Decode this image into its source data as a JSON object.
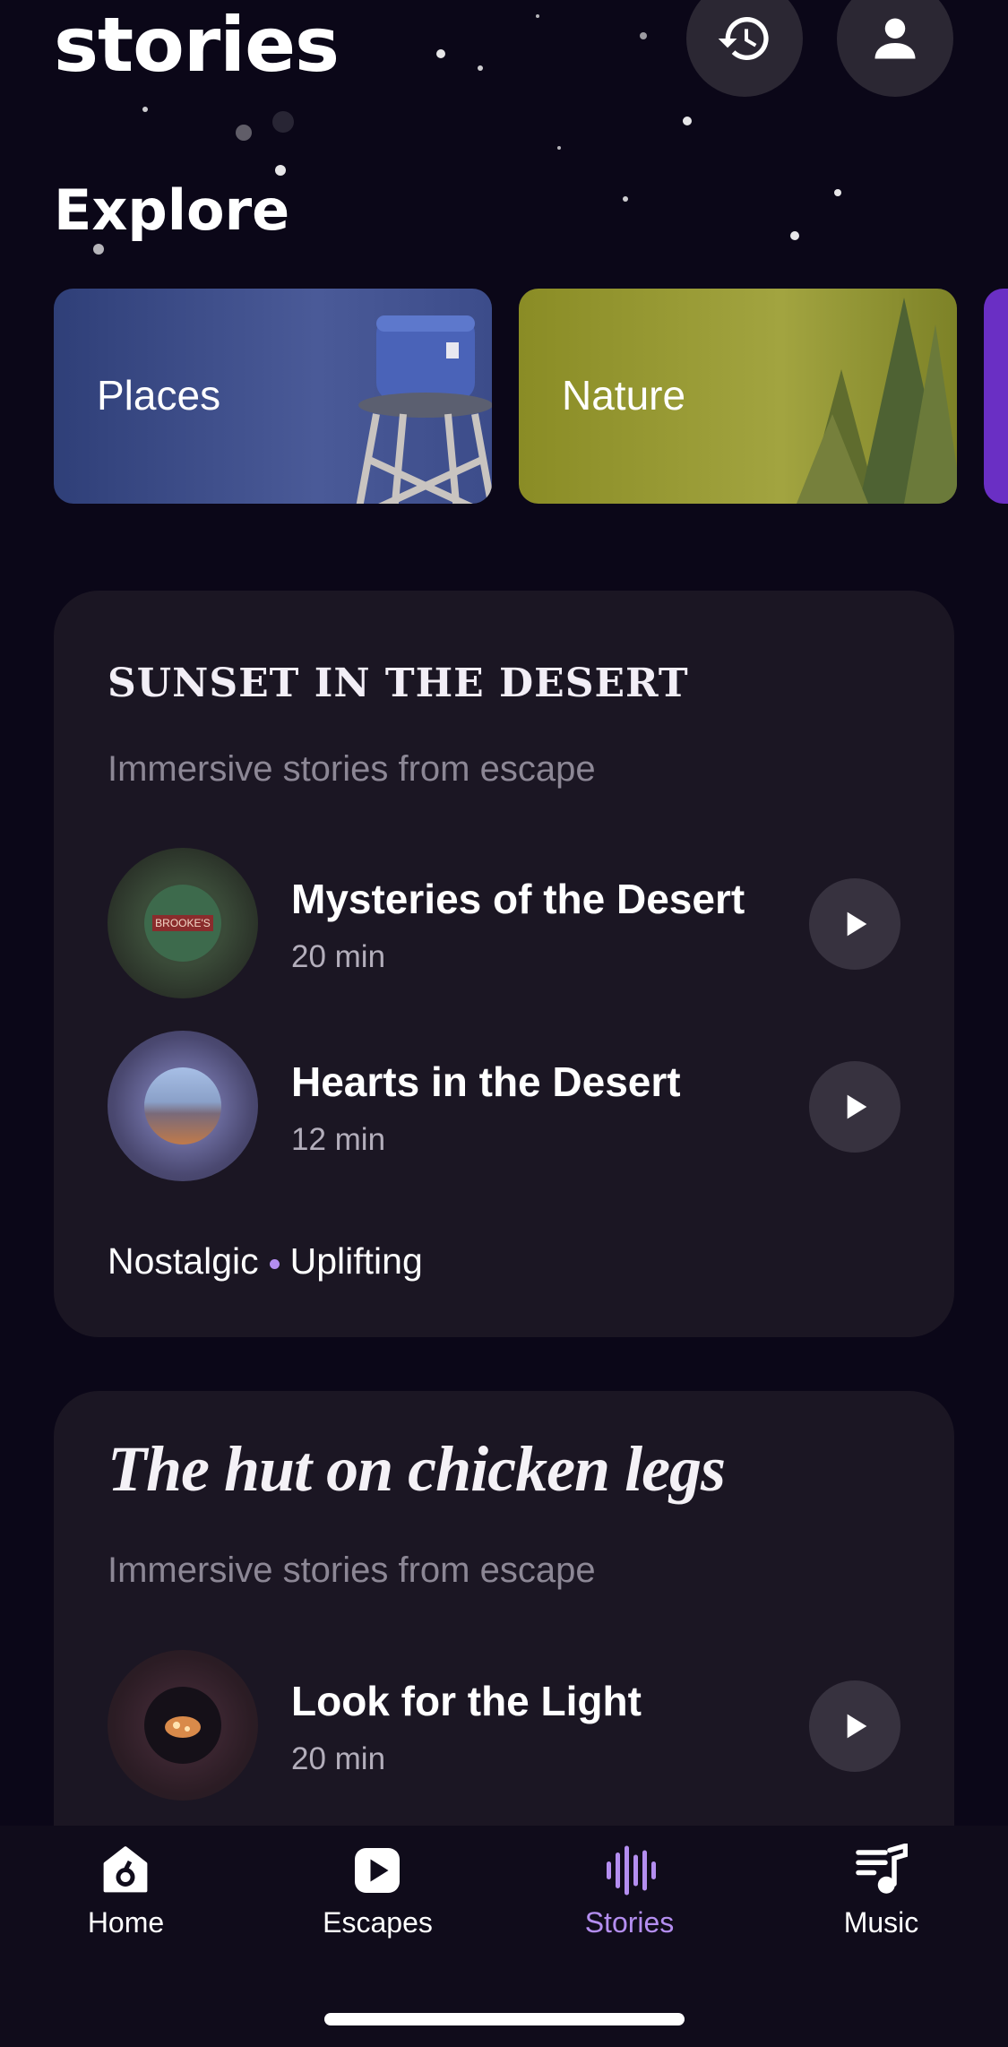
{
  "app": {
    "title": "stories"
  },
  "header": {
    "history_icon": "history-icon",
    "profile_icon": "profile-icon"
  },
  "explore": {
    "title": "Explore",
    "categories": [
      {
        "label": "Places",
        "color": "#3b4a86"
      },
      {
        "label": "Nature",
        "color": "#8c8f2b"
      },
      {
        "label": "",
        "color": "#6a2fc4"
      }
    ]
  },
  "collections": [
    {
      "title": "SUNSET IN THE DESERT",
      "subtitle": "Immersive stories from escape",
      "items": [
        {
          "title": "Mysteries of the Desert",
          "duration": "20 min",
          "thumb_text": "BROOKE'S"
        },
        {
          "title": "Hearts in the Desert",
          "duration": "12 min"
        }
      ],
      "tags": [
        "Nostalgic",
        "Uplifting"
      ]
    },
    {
      "title": "The hut on chicken legs",
      "subtitle": "Immersive stories from escape",
      "items": [
        {
          "title": "Look for the Light",
          "duration": "20 min"
        }
      ]
    }
  ],
  "nav": {
    "items": [
      {
        "label": "Home",
        "icon": "home-icon",
        "active": false
      },
      {
        "label": "Escapes",
        "icon": "play-square-icon",
        "active": false
      },
      {
        "label": "Stories",
        "icon": "soundwave-icon",
        "active": true
      },
      {
        "label": "Music",
        "icon": "music-note-icon",
        "active": false
      }
    ],
    "active_color": "#b48ef0"
  }
}
